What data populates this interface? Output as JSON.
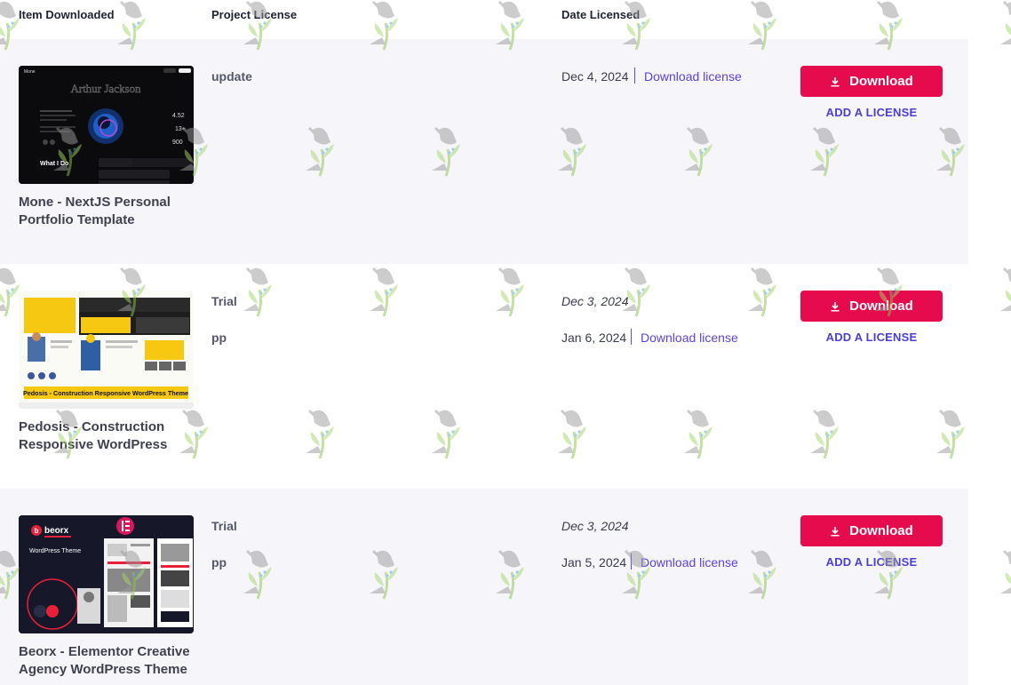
{
  "columns": {
    "item": "Item Downloaded",
    "license": "Project License",
    "date": "Date Licensed"
  },
  "rows": [
    {
      "title": "Mone - NextJS Personal Portfolio Template",
      "thumb_heading": "Arthur Jackson",
      "thumb_tag": "What I Do",
      "licenses": [
        {
          "name": "update",
          "date": "Dec 4, 2024",
          "link": "Download license"
        }
      ],
      "download_label": "Download",
      "add_license_label": "ADD A LICENSE"
    },
    {
      "title": "Pedosis - Construction Responsive WordPress",
      "thumb_banner": "Pedosis - Construction Responsive WordPress Theme",
      "licenses": [
        {
          "name": "Trial",
          "date": "Dec 3, 2024"
        },
        {
          "name": "pp",
          "date": "Jan 6, 2024",
          "link": "Download license"
        }
      ],
      "download_label": "Download",
      "add_license_label": "ADD A LICENSE"
    },
    {
      "title": "Beorx - Elementor Creative Agency WordPress Theme",
      "thumb_brand": "beorx",
      "thumb_sub": "WordPress Theme",
      "licenses": [
        {
          "name": "Trial",
          "date": "Dec 3, 2024"
        },
        {
          "name": "pp",
          "date": "Jan 5, 2024",
          "link": "Download license"
        }
      ],
      "download_label": "Download",
      "add_license_label": "ADD A LICENSE"
    }
  ],
  "colors": {
    "download_button": "#e50b4d",
    "link": "#5b43d6",
    "row_alt": "#f6f6fa"
  },
  "icons": {
    "download": "download-icon",
    "watermark": "watering-can-plant-icon"
  }
}
